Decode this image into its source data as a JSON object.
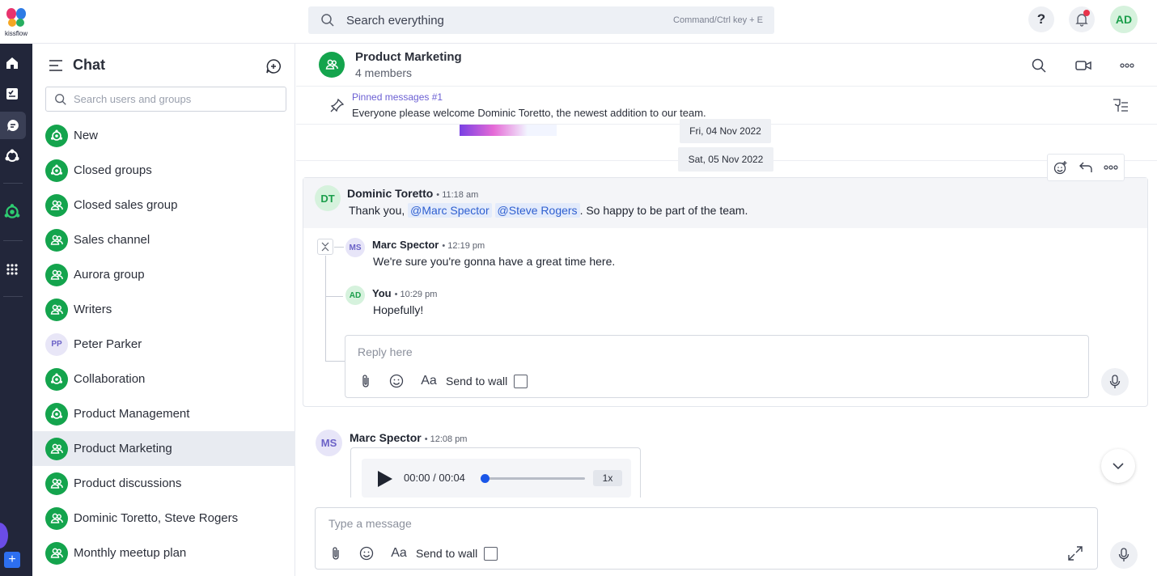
{
  "app": {
    "brand": "kissflow"
  },
  "topbar": {
    "search_placeholder": "Search everything",
    "search_shortcut": "Command/Ctrl key + E",
    "help": "?",
    "user_initials": "AD"
  },
  "sidebar": {
    "title": "Chat",
    "search_placeholder": "Search users and groups",
    "items": [
      {
        "label": "New",
        "icon": "hub-icon"
      },
      {
        "label": "Closed groups",
        "icon": "hub-icon"
      },
      {
        "label": "Closed sales group",
        "icon": "group-icon"
      },
      {
        "label": "Sales channel",
        "icon": "group-icon"
      },
      {
        "label": "Aurora group",
        "icon": "group-icon"
      },
      {
        "label": "Writers",
        "icon": "group-icon"
      },
      {
        "label": "Peter Parker",
        "icon": "avatar",
        "initials": "PP"
      },
      {
        "label": "Collaboration",
        "icon": "hub-icon"
      },
      {
        "label": "Product Management",
        "icon": "hub-icon"
      },
      {
        "label": "Product Marketing",
        "icon": "group-icon",
        "active": true
      },
      {
        "label": "Product discussions",
        "icon": "group-icon"
      },
      {
        "label": "Dominic Toretto, Steve Rogers",
        "icon": "group-icon"
      },
      {
        "label": "Monthly meetup plan",
        "icon": "group-icon"
      }
    ]
  },
  "chat": {
    "name": "Product Marketing",
    "members": "4 members",
    "pinned_title": "Pinned messages #1",
    "pinned_text": "Everyone please welcome Dominic Toretto, the newest addition to our team.",
    "dates": [
      "Fri, 04 Nov 2022",
      "Sat, 05 Nov 2022"
    ],
    "thread": {
      "author_initials": "DT",
      "author": "Dominic Toretto",
      "time": "• 11:18 am",
      "text_before": "Thank you, ",
      "mention1": "@Marc Spector",
      "mention2": "@Steve Rogers",
      "text_after": ". So happy to be part of the team.",
      "replies": [
        {
          "initials": "MS",
          "author": "Marc Spector",
          "time": "• 12:19 pm",
          "text": "We're sure you're gonna have a great time here."
        },
        {
          "initials": "AD",
          "author": "You",
          "time": "• 10:29 pm",
          "text": "Hopefully!"
        }
      ],
      "reply_placeholder": "Reply here",
      "send_to_wall": "Send to wall",
      "format_label": "Aa"
    },
    "audio_message": {
      "initials": "MS",
      "author": "Marc Spector",
      "time": "• 12:08 pm",
      "time_display": "00:00 / 00:04",
      "speed": "1x",
      "progress": 0
    },
    "composer": {
      "placeholder": "Type a message",
      "send_to_wall": "Send to wall",
      "format_label": "Aa"
    }
  },
  "colors": {
    "brand_green": "#14a44d",
    "rail": "#22263a",
    "accent_purple": "#6b5fd3",
    "mention_blue": "#2e5fd0"
  }
}
